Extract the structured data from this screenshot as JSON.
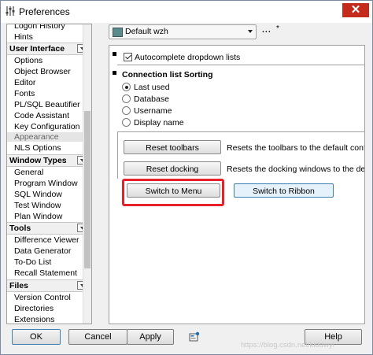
{
  "window": {
    "title": "Preferences",
    "close_label": "✕",
    "title_icon": "sliders-icon"
  },
  "nav": {
    "items_top": [
      "Logon History",
      "Hints"
    ],
    "sections": [
      {
        "header": "User Interface",
        "items": [
          "Options",
          "Object Browser",
          "Editor",
          "Fonts",
          "PL/SQL Beautifier",
          "Code Assistant",
          "Key Configuration",
          "Appearance",
          "NLS Options"
        ],
        "selected": "Appearance"
      },
      {
        "header": "Window Types",
        "items": [
          "General",
          "Program Window",
          "SQL Window",
          "Test Window",
          "Plan Window"
        ]
      },
      {
        "header": "Tools",
        "items": [
          "Difference Viewer",
          "Data Generator",
          "To-Do List",
          "Recall Statement"
        ]
      },
      {
        "header": "Files",
        "items": [
          "Version Control",
          "Directories",
          "Extensions"
        ]
      }
    ]
  },
  "toolbar": {
    "template_value": "Default wzh",
    "more_label": "...",
    "modified_marker": "*"
  },
  "appearance": {
    "autocomplete_label": "Autocomplete dropdown lists",
    "autocomplete_checked": true,
    "conn_sort_title": "Connection list Sorting",
    "sort_options": [
      "Last used",
      "Database",
      "Username",
      "Display name"
    ],
    "sort_selected": "Last used",
    "reset_toolbars_label": "Reset toolbars",
    "reset_toolbars_desc": "Resets the toolbars to the default conf",
    "reset_docking_label": "Reset docking",
    "reset_docking_desc": "Resets the docking windows to the def",
    "switch_menu_label": "Switch to Menu",
    "switch_ribbon_label": "Switch to Ribbon"
  },
  "footer": {
    "ok_label": "OK",
    "cancel_label": "Cancel",
    "apply_label": "Apply",
    "help_label": "Help",
    "pin_icon": "pin-icon",
    "watermark": "https://blog.csdn.net/kiddwyl"
  },
  "colors": {
    "highlight": "#e8202a",
    "ribbon_button_border": "#3c7fb1",
    "close_button": "#c42b1c"
  }
}
